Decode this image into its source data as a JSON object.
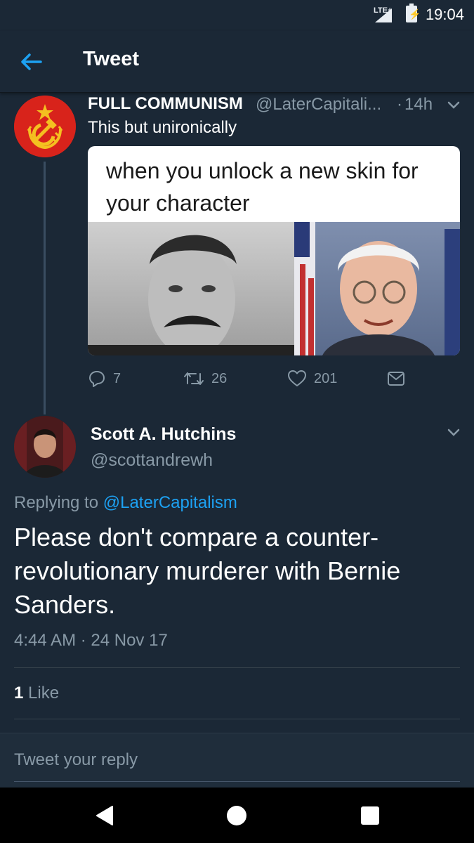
{
  "status_bar": {
    "network": "LTE+",
    "time": "19:04",
    "icons": [
      "signal-icon",
      "battery-charging-icon"
    ]
  },
  "header": {
    "title": "Tweet",
    "back_icon": "arrow-left-icon"
  },
  "parent_tweet": {
    "avatar_icon": "hammer-sickle-avatar",
    "author_name": "FULL COMMUNISM",
    "author_handle": "@LaterCapitali...",
    "separator": "·",
    "time": "14h",
    "text": "This but unironically",
    "image_caption": "when you unlock a new skin for your character",
    "actions": {
      "replies": "7",
      "retweets": "26",
      "likes": "201"
    }
  },
  "reply_tweet": {
    "author_name": "Scott A. Hutchins",
    "author_handle": "@scottandrewh",
    "replying_prefix": "Replying to",
    "replying_mention": "@LaterCapitalism",
    "text": "Please don't compare a counter-revolutionary murderer with Bernie Sanders.",
    "timestamp": "4:44 AM · 24 Nov 17",
    "like_count": "1",
    "like_label": "Like"
  },
  "reply_box": {
    "placeholder": "Tweet your reply"
  },
  "nav_bar": {
    "icons": [
      "back-triangle-icon",
      "home-circle-icon",
      "recents-square-icon"
    ]
  },
  "colors": {
    "background": "#1b2836",
    "accent": "#1da1f2",
    "muted_text": "#8899a6",
    "avatar_red": "#d8231b"
  }
}
